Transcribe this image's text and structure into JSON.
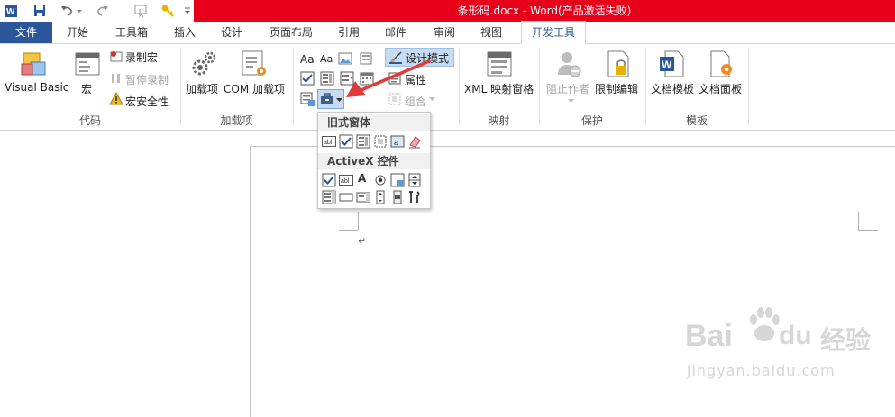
{
  "window": {
    "title": "条形码.docx - Word(产品激活失败)"
  },
  "tabs": [
    "文件",
    "开始",
    "工具箱",
    "插入",
    "设计",
    "页面布局",
    "引用",
    "邮件",
    "审阅",
    "视图",
    "开发工具"
  ],
  "ribbon": {
    "code": {
      "label": "代码",
      "visual_basic": "Visual Basic",
      "macros": "宏",
      "record_macro": "录制宏",
      "pause_recording": "暂停录制",
      "macro_security": "宏安全性"
    },
    "addins": {
      "label": "加载项",
      "addins": "加载项",
      "com_addins": "COM 加载项"
    },
    "controls": {
      "aa1": "Aa",
      "aa2": "Aa",
      "design_mode": "设计模式",
      "properties": "属性",
      "group": "组合"
    },
    "mapping": {
      "label": "映射",
      "xml_pane": "XML 映射窗格"
    },
    "protect": {
      "label": "保护",
      "block_authors": "阻止作者",
      "restrict_editing": "限制编辑"
    },
    "templates": {
      "label": "模板",
      "doc_template": "文档模板",
      "doc_panel": "文档面板"
    }
  },
  "popup": {
    "legacy_header": "旧式窗体",
    "activex_header": "ActiveX 控件",
    "label_a": "A"
  },
  "document": {
    "paragraph_mark": "↵"
  },
  "watermark": {
    "brand": "Bai",
    "brand2": "du",
    "brand3": "经验",
    "url": "jingyan.baidu.com"
  },
  "colors": {
    "title_red": "#e8001b",
    "file_blue": "#2b579a",
    "arrow_red": "#e03a3a"
  }
}
